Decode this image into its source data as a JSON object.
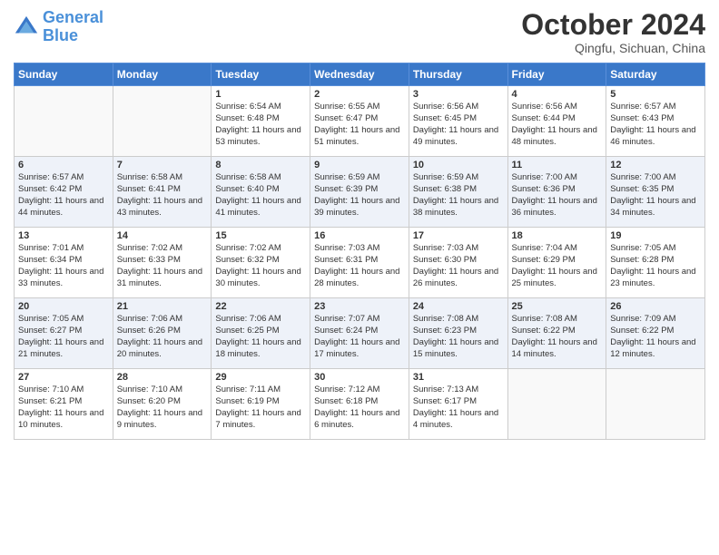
{
  "logo": {
    "line1": "General",
    "line2": "Blue"
  },
  "title": "October 2024",
  "subtitle": "Qingfu, Sichuan, China",
  "days_of_week": [
    "Sunday",
    "Monday",
    "Tuesday",
    "Wednesday",
    "Thursday",
    "Friday",
    "Saturday"
  ],
  "weeks": [
    [
      {
        "day": "",
        "info": ""
      },
      {
        "day": "",
        "info": ""
      },
      {
        "day": "1",
        "info": "Sunrise: 6:54 AM\nSunset: 6:48 PM\nDaylight: 11 hours and 53 minutes."
      },
      {
        "day": "2",
        "info": "Sunrise: 6:55 AM\nSunset: 6:47 PM\nDaylight: 11 hours and 51 minutes."
      },
      {
        "day": "3",
        "info": "Sunrise: 6:56 AM\nSunset: 6:45 PM\nDaylight: 11 hours and 49 minutes."
      },
      {
        "day": "4",
        "info": "Sunrise: 6:56 AM\nSunset: 6:44 PM\nDaylight: 11 hours and 48 minutes."
      },
      {
        "day": "5",
        "info": "Sunrise: 6:57 AM\nSunset: 6:43 PM\nDaylight: 11 hours and 46 minutes."
      }
    ],
    [
      {
        "day": "6",
        "info": "Sunrise: 6:57 AM\nSunset: 6:42 PM\nDaylight: 11 hours and 44 minutes."
      },
      {
        "day": "7",
        "info": "Sunrise: 6:58 AM\nSunset: 6:41 PM\nDaylight: 11 hours and 43 minutes."
      },
      {
        "day": "8",
        "info": "Sunrise: 6:58 AM\nSunset: 6:40 PM\nDaylight: 11 hours and 41 minutes."
      },
      {
        "day": "9",
        "info": "Sunrise: 6:59 AM\nSunset: 6:39 PM\nDaylight: 11 hours and 39 minutes."
      },
      {
        "day": "10",
        "info": "Sunrise: 6:59 AM\nSunset: 6:38 PM\nDaylight: 11 hours and 38 minutes."
      },
      {
        "day": "11",
        "info": "Sunrise: 7:00 AM\nSunset: 6:36 PM\nDaylight: 11 hours and 36 minutes."
      },
      {
        "day": "12",
        "info": "Sunrise: 7:00 AM\nSunset: 6:35 PM\nDaylight: 11 hours and 34 minutes."
      }
    ],
    [
      {
        "day": "13",
        "info": "Sunrise: 7:01 AM\nSunset: 6:34 PM\nDaylight: 11 hours and 33 minutes."
      },
      {
        "day": "14",
        "info": "Sunrise: 7:02 AM\nSunset: 6:33 PM\nDaylight: 11 hours and 31 minutes."
      },
      {
        "day": "15",
        "info": "Sunrise: 7:02 AM\nSunset: 6:32 PM\nDaylight: 11 hours and 30 minutes."
      },
      {
        "day": "16",
        "info": "Sunrise: 7:03 AM\nSunset: 6:31 PM\nDaylight: 11 hours and 28 minutes."
      },
      {
        "day": "17",
        "info": "Sunrise: 7:03 AM\nSunset: 6:30 PM\nDaylight: 11 hours and 26 minutes."
      },
      {
        "day": "18",
        "info": "Sunrise: 7:04 AM\nSunset: 6:29 PM\nDaylight: 11 hours and 25 minutes."
      },
      {
        "day": "19",
        "info": "Sunrise: 7:05 AM\nSunset: 6:28 PM\nDaylight: 11 hours and 23 minutes."
      }
    ],
    [
      {
        "day": "20",
        "info": "Sunrise: 7:05 AM\nSunset: 6:27 PM\nDaylight: 11 hours and 21 minutes."
      },
      {
        "day": "21",
        "info": "Sunrise: 7:06 AM\nSunset: 6:26 PM\nDaylight: 11 hours and 20 minutes."
      },
      {
        "day": "22",
        "info": "Sunrise: 7:06 AM\nSunset: 6:25 PM\nDaylight: 11 hours and 18 minutes."
      },
      {
        "day": "23",
        "info": "Sunrise: 7:07 AM\nSunset: 6:24 PM\nDaylight: 11 hours and 17 minutes."
      },
      {
        "day": "24",
        "info": "Sunrise: 7:08 AM\nSunset: 6:23 PM\nDaylight: 11 hours and 15 minutes."
      },
      {
        "day": "25",
        "info": "Sunrise: 7:08 AM\nSunset: 6:22 PM\nDaylight: 11 hours and 14 minutes."
      },
      {
        "day": "26",
        "info": "Sunrise: 7:09 AM\nSunset: 6:22 PM\nDaylight: 11 hours and 12 minutes."
      }
    ],
    [
      {
        "day": "27",
        "info": "Sunrise: 7:10 AM\nSunset: 6:21 PM\nDaylight: 11 hours and 10 minutes."
      },
      {
        "day": "28",
        "info": "Sunrise: 7:10 AM\nSunset: 6:20 PM\nDaylight: 11 hours and 9 minutes."
      },
      {
        "day": "29",
        "info": "Sunrise: 7:11 AM\nSunset: 6:19 PM\nDaylight: 11 hours and 7 minutes."
      },
      {
        "day": "30",
        "info": "Sunrise: 7:12 AM\nSunset: 6:18 PM\nDaylight: 11 hours and 6 minutes."
      },
      {
        "day": "31",
        "info": "Sunrise: 7:13 AM\nSunset: 6:17 PM\nDaylight: 11 hours and 4 minutes."
      },
      {
        "day": "",
        "info": ""
      },
      {
        "day": "",
        "info": ""
      }
    ]
  ]
}
